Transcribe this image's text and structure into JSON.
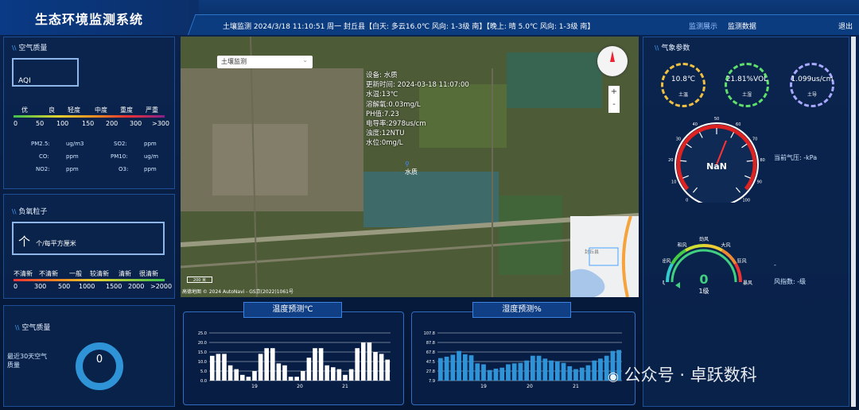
{
  "header": {
    "title": "生态环境监测系统",
    "info": "土壤监测  2024/3/18 11:10:51 周一  封丘县【白天: 多云16.0℃ 风向: 1-3级 南】【晚上: 晴 5.0℃ 风向: 1-3级 南】",
    "nav": [
      "监测展示",
      "监测数据"
    ],
    "logout": "退出"
  },
  "air_quality": {
    "title": "空气质量",
    "aqi_label": "AQI",
    "levels": [
      "优",
      "良",
      "轻度",
      "中度",
      "重度",
      "严重"
    ],
    "scale": [
      "0",
      "50",
      "100",
      "150",
      "200",
      "300",
      ">300"
    ],
    "items": [
      {
        "label": "PM2.5:",
        "unit": "ug/m3"
      },
      {
        "label": "SO2:",
        "unit": "ppm"
      },
      {
        "label": "CO:",
        "unit": "ppm"
      },
      {
        "label": "PM10:",
        "unit": "ug/m"
      },
      {
        "label": "NO2:",
        "unit": "ppm"
      },
      {
        "label": "O3:",
        "unit": "ppm"
      }
    ]
  },
  "anion": {
    "title": "负氧粒子",
    "value_label": "个/每平方厘米",
    "levels": [
      "不清新",
      "不清新",
      "一般",
      "较清新",
      "清新",
      "很清新"
    ],
    "scale": [
      "0",
      "300",
      "500",
      "1000",
      "1500",
      "2000",
      ">2000"
    ]
  },
  "air30": {
    "title": "空气质量",
    "label": "最近30天空气质量",
    "value": "0"
  },
  "map": {
    "select": "土壤监测",
    "info": [
      "设备: 水质",
      "更新时间: 2024-03-18 11:07:00",
      "水温:13℃",
      "溶解氧:0.03mg/L",
      "PH值:7.23",
      "电导率:2978us/cm",
      "浊度:12NTU",
      "水位:0mg/L"
    ],
    "marker": "水质",
    "footer": "高德地图  © 2024 AutoNavi - GS京(2022)1061号",
    "scale": "200 米",
    "zoom_in": "+",
    "zoom_out": "-",
    "minimap_label": "封丘县"
  },
  "weather": {
    "title": "气象参数",
    "gauges": [
      {
        "value": "10.8℃",
        "label": "土温",
        "color": "#f0c040"
      },
      {
        "value": "21.81%VOL",
        "label": "土湿",
        "color": "#5fe06a"
      },
      {
        "value": "1.099us/cm",
        "label": "土导",
        "color": "#a8a8ff"
      }
    ],
    "pressure": {
      "label": "当前气压: -kPa",
      "value": "NaN",
      "ticks": [
        "0",
        "10",
        "20",
        "30",
        "40",
        "50",
        "60",
        "70",
        "80",
        "90",
        "100"
      ]
    },
    "wind": {
      "label": "风指数: -级",
      "value": "0",
      "level": "1级",
      "dash": "-",
      "scale": [
        "无风",
        "轻风",
        "和风",
        "劲风",
        "大风",
        "狂风",
        "暴风"
      ]
    }
  },
  "chart_data": [
    {
      "type": "bar",
      "title": "温度预测℃",
      "x_ticks": [
        "19",
        "20",
        "21"
      ],
      "y_ticks": [
        "0.0",
        "5.0",
        "10.0",
        "15.0",
        "20.0",
        "25.0"
      ],
      "ylim": [
        0,
        25
      ],
      "values": [
        13,
        14,
        14,
        8,
        6,
        3,
        2,
        5,
        14,
        17,
        17,
        9,
        8,
        2,
        2,
        5,
        12,
        17,
        17,
        8,
        7,
        6,
        3,
        6,
        17,
        20,
        20,
        15,
        14,
        11
      ],
      "color": "#ffffff"
    },
    {
      "type": "bar",
      "title": "湿度预测%",
      "x_ticks": [
        "19",
        "20",
        "21"
      ],
      "y_ticks": [
        "7.9",
        "27.8",
        "47.5",
        "67.8",
        "87.8",
        "107.8"
      ],
      "ylim": [
        7.9,
        107.8
      ],
      "values": [
        55,
        58,
        62,
        70,
        63,
        61,
        44,
        42,
        30,
        33,
        35,
        42,
        44,
        45,
        50,
        60,
        60,
        54,
        50,
        48,
        45,
        38,
        32,
        35,
        40,
        50,
        54,
        60,
        70,
        72
      ],
      "color": "#2f93d8"
    }
  ],
  "watermark": "公众号 · 卓跃数科"
}
